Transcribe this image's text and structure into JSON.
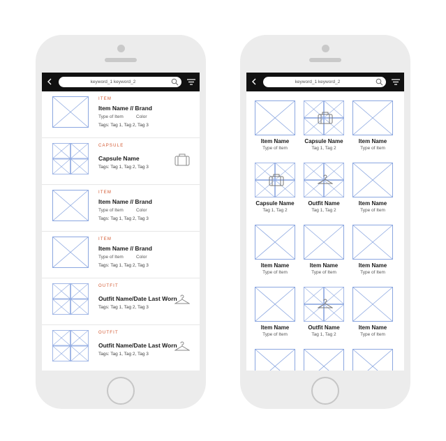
{
  "left_screen": {
    "search_query": "keyword_1 keyword_2",
    "rows": [
      {
        "category": "ITEM",
        "title": "Item Name // Brand",
        "type": "Type of Item",
        "color": "Color",
        "tags": "Tags: Tag 1, Tag 2, Tag 3",
        "thumb": "single",
        "icon": ""
      },
      {
        "category": "CAPSULE",
        "title": "Capsule Name",
        "type": "",
        "color": "",
        "tags": "Tags: Tag 1, Tag 2, Tag 3",
        "thumb": "grid",
        "icon": "suitcase-icon"
      },
      {
        "category": "ITEM",
        "title": "Item Name // Brand",
        "type": "Type of Item",
        "color": "Color",
        "tags": "Tags: Tag 1, Tag 2, Tag 3",
        "thumb": "single",
        "icon": ""
      },
      {
        "category": "ITEM",
        "title": "Item Name // Brand",
        "type": "Type of Item",
        "color": "Color",
        "tags": "Tags: Tag 1, Tag 2, Tag 3",
        "thumb": "single",
        "icon": ""
      },
      {
        "category": "OUTFIT",
        "title": "Outfit Name/Date Last Worn",
        "type": "",
        "color": "",
        "tags": "Tags: Tag 1, Tag 2, Tag 3",
        "thumb": "grid",
        "icon": "hanger-icon"
      },
      {
        "category": "OUTFIT",
        "title": "Outfit Name/Date Last Worn",
        "type": "",
        "color": "",
        "tags": "Tags: Tag 1, Tag 2, Tag 3",
        "thumb": "grid",
        "icon": "hanger-icon"
      }
    ]
  },
  "right_screen": {
    "search_query": "keyword_1 keyword_2",
    "cells": [
      {
        "name": "Item Name",
        "sub": "Type of Item",
        "kind": "item"
      },
      {
        "name": "Capsule Name",
        "sub": "Tag 1, Tag 2",
        "kind": "capsule"
      },
      {
        "name": "Item Name",
        "sub": "Type of Item",
        "kind": "item"
      },
      {
        "name": "Capsule Name",
        "sub": "Tag 1, Tag 2",
        "kind": "capsule"
      },
      {
        "name": "Outfit Name",
        "sub": "Tag 1, Tag 2",
        "kind": "outfit"
      },
      {
        "name": "Item Name",
        "sub": "Type of Item",
        "kind": "item"
      },
      {
        "name": "Item Name",
        "sub": "Type of Item",
        "kind": "item"
      },
      {
        "name": "Item Name",
        "sub": "Type of Item",
        "kind": "item"
      },
      {
        "name": "Item Name",
        "sub": "Type of Item",
        "kind": "item"
      },
      {
        "name": "Item Name",
        "sub": "Type of Item",
        "kind": "item"
      },
      {
        "name": "Outfit Name",
        "sub": "Tag 1, Tag 2",
        "kind": "outfit"
      },
      {
        "name": "Item Name",
        "sub": "Type of Item",
        "kind": "item"
      },
      {
        "name": "",
        "sub": "",
        "kind": "item"
      },
      {
        "name": "",
        "sub": "",
        "kind": "item"
      },
      {
        "name": "",
        "sub": "",
        "kind": "item"
      }
    ]
  },
  "icons": {
    "back": "back-arrow-icon",
    "search": "search-icon",
    "filter": "filter-icon"
  },
  "colors": {
    "placeholder_line": "#8aa6e0",
    "category": "#d2542c",
    "topbar": "#111111"
  }
}
